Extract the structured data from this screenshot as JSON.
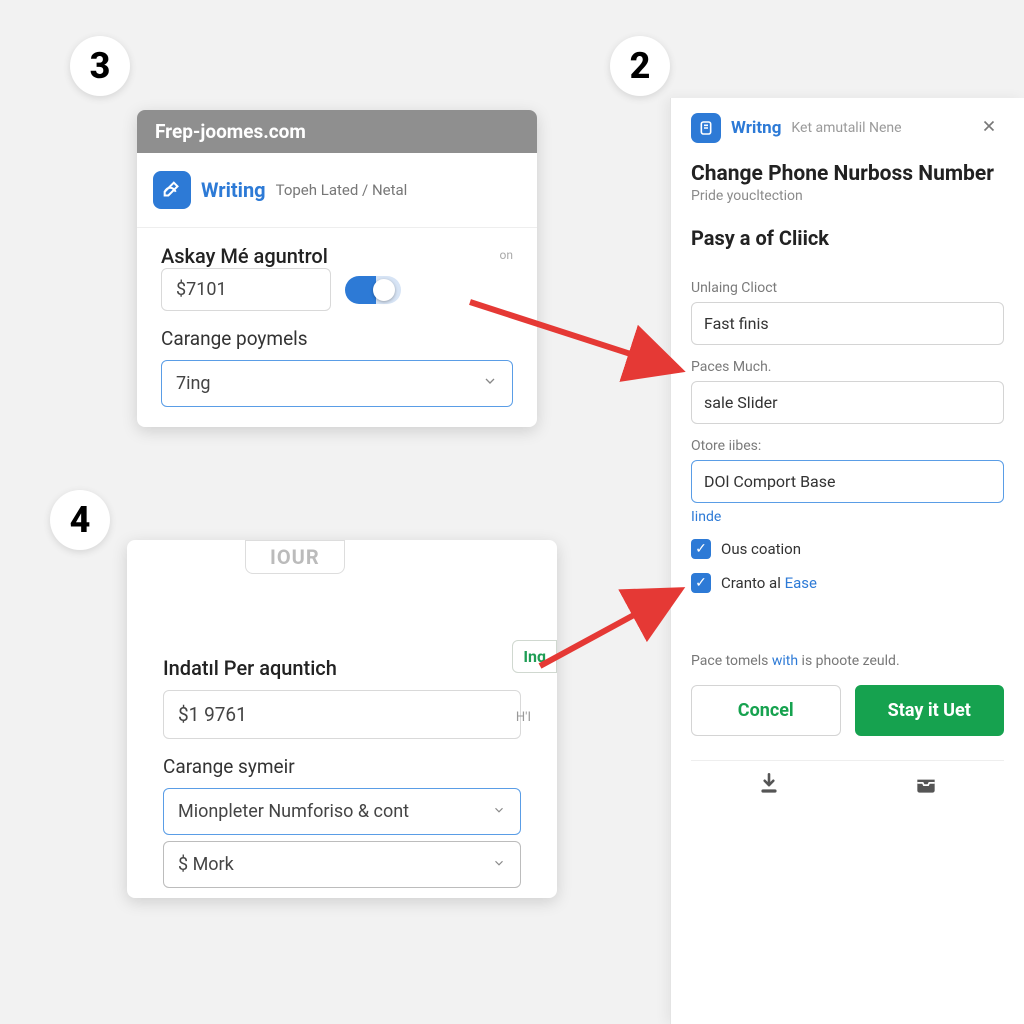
{
  "steps": {
    "badge3": "3",
    "badge2": "2",
    "badge4": "4"
  },
  "panel3": {
    "titlebar": "Frep-joomes.com",
    "brand": "Writing",
    "crumb": "Topeh Lated / Netal",
    "section1_label": "Askay Mé aguntrol",
    "section1_rt": "on",
    "value": "$7101",
    "section2_label": "Carange poymels",
    "select_value": "7ing"
  },
  "panel4": {
    "chip": "IOUR",
    "tag": "Inq",
    "section_label": "Indatıl Per aquntich",
    "rt": "H'I",
    "value": "$1 9761",
    "section2_label": "Carange symeir",
    "select1": "Mionpleter Numforiso & cont",
    "select2": "$ Mork"
  },
  "panel2": {
    "brand": "Writng",
    "sub": "Ket amutalil Nene",
    "title": "Change Phone Nurboss Number",
    "subtitle": "Pride youcltection",
    "section": "Pasy a of Cliick",
    "f1_label": "Unlaing Clioct",
    "f1_value": "Fast finis",
    "f2_label": "Paces Much.",
    "f2_value": "sale Slider",
    "f3_label": "Otore iibes:",
    "f3_value": "DOl Comport Base",
    "link": "Iinde",
    "chk1": "Ous coation",
    "chk2_a": "Cranto al",
    "chk2_b": "Ease",
    "foot_a": "Pace tomels",
    "foot_b": "with",
    "foot_c": "is phoote zeuld.",
    "btn_cancel": "Concel",
    "btn_primary": "Stay it Uet"
  },
  "colors": {
    "accent_blue": "#2d7ad6",
    "accent_green": "#16a24f",
    "arrow": "#e53935"
  }
}
